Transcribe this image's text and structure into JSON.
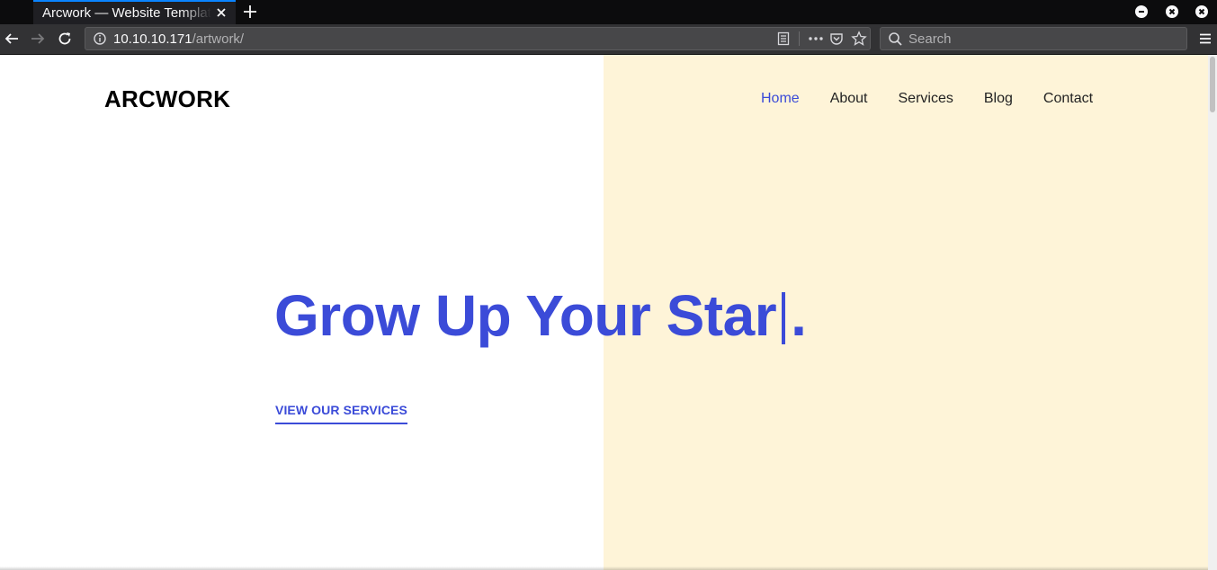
{
  "browser": {
    "tab_title": "Arcwork — Website Template",
    "url_host": "10.10.10.171",
    "url_path": "/artwork/",
    "search_placeholder": "Search"
  },
  "site": {
    "logo": "ARCWORK",
    "nav": [
      {
        "label": "Home",
        "active": true
      },
      {
        "label": "About",
        "active": false
      },
      {
        "label": "Services",
        "active": false
      },
      {
        "label": "Blog",
        "active": false
      },
      {
        "label": "Contact",
        "active": false
      }
    ],
    "headline_main": "Grow Up Your Star",
    "headline_end": ".",
    "cta": "VIEW OUR SERVICES"
  },
  "colors": {
    "accent": "#3b4bd8",
    "hero_right_bg": "#fef4d8"
  }
}
